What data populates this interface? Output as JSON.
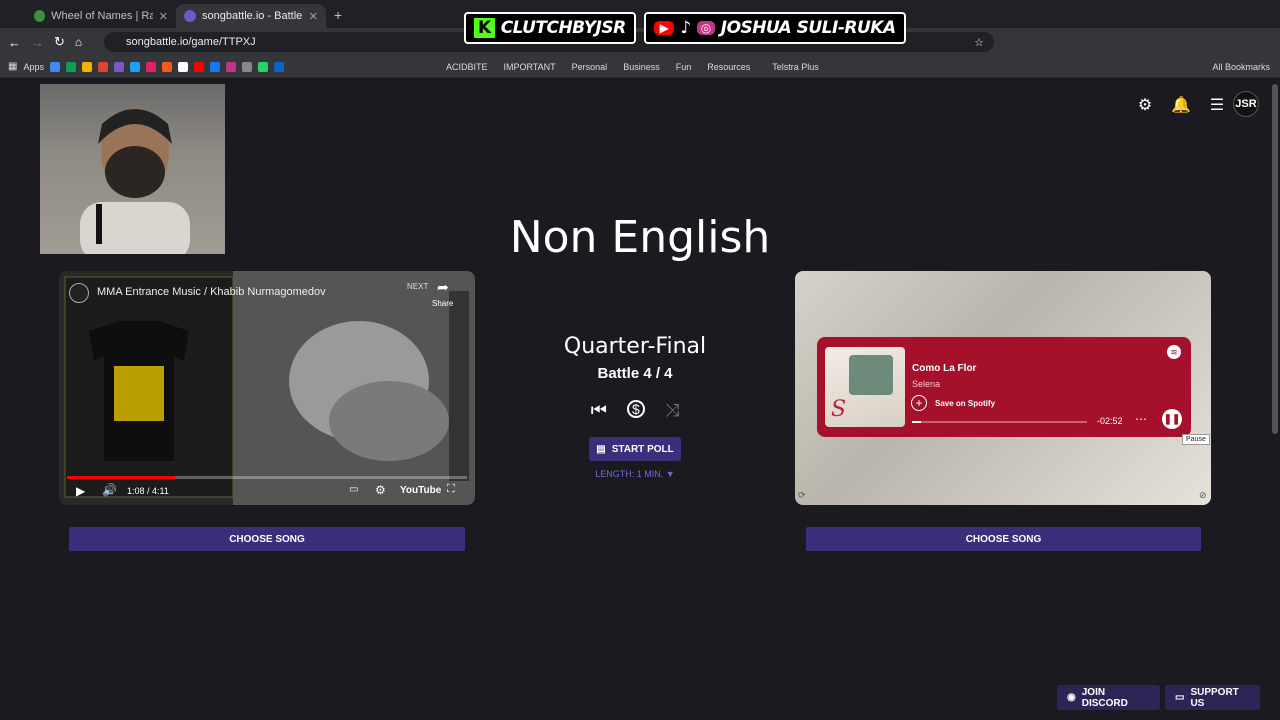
{
  "tabs": [
    {
      "title": "Wheel of Names | Random nam",
      "color": "#3c8d3c"
    },
    {
      "title": "songbattle.io - Battle Song",
      "color": "#6a5acd"
    }
  ],
  "address": "songbattle.io/game/TTPXJ",
  "bookmarks": {
    "apps": "Apps",
    "folders": [
      "ACIDBITE",
      "IMPORTANT",
      "Personal",
      "Business",
      "Fun",
      "Resources",
      "Telstra Plus"
    ],
    "all": "All Bookmarks"
  },
  "banner": {
    "handle1": "CLUTCHBYJSR",
    "handle2": "JOSHUA SULI-RUKA"
  },
  "category": "Non English",
  "round": "Quarter-Final",
  "battle": "Battle 4 / 4",
  "poll_label": "START POLL",
  "poll_length": "LENGTH: 1 MIN. ▼",
  "left_song": {
    "video_title": "MMA Entrance Music / Khabib Nurmagomedov",
    "time": "1:08 / 4:11",
    "progress": 0.27,
    "choose_label": "CHOOSE SONG",
    "next_label": "NEXT",
    "share_label": "Share",
    "platform": "YouTube"
  },
  "right_song": {
    "track": "Como La Flor",
    "artist": "Selena",
    "save_label": "Save on Spotify",
    "remaining": "-02:52",
    "progress": 0.05,
    "tooltip": "Pause",
    "choose_label": "CHOOSE SONG"
  },
  "footer": {
    "discord": "JOIN DISCORD",
    "support": "SUPPORT US"
  },
  "avatar": "JSR",
  "colors": {
    "accent": "#3a2f7a",
    "spotify": "#a5102a",
    "page": "#1b1a21"
  }
}
